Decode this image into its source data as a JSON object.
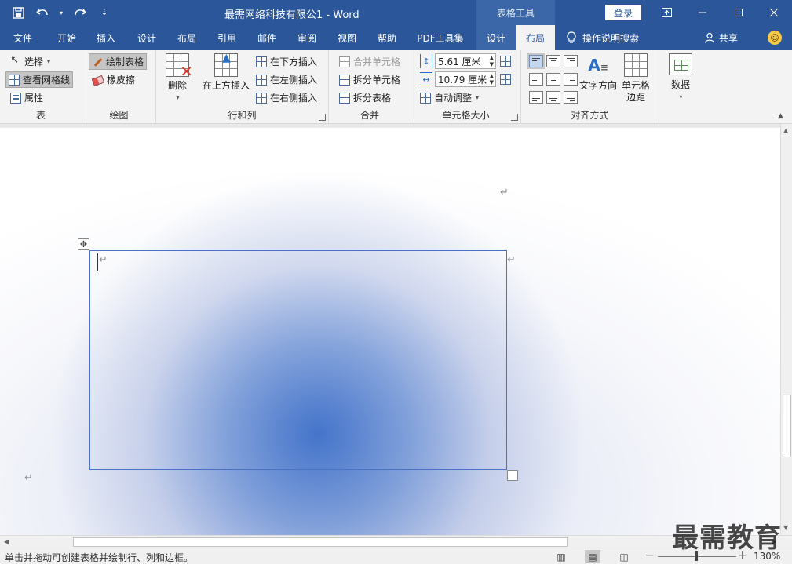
{
  "titlebar": {
    "doc_title": "最需网络科技有限公1 - Word",
    "context_tab_header": "表格工具",
    "login_label": "登录",
    "qat_icons": [
      "save-icon",
      "undo-icon",
      "redo-icon",
      "customize-icon"
    ],
    "window_icons": [
      "ribbon-display-icon",
      "minimize-icon",
      "maximize-icon",
      "close-icon"
    ]
  },
  "tabs": [
    {
      "label": "文件"
    },
    {
      "label": "开始"
    },
    {
      "label": "插入"
    },
    {
      "label": "设计"
    },
    {
      "label": "布局"
    },
    {
      "label": "引用"
    },
    {
      "label": "邮件"
    },
    {
      "label": "审阅"
    },
    {
      "label": "视图"
    },
    {
      "label": "帮助"
    },
    {
      "label": "PDF工具集"
    },
    {
      "label": "设计"
    },
    {
      "label": "布局"
    }
  ],
  "tell_me": "操作说明搜索",
  "share_label": "共享",
  "ribbon": {
    "table_group": {
      "label": "表",
      "select": "选择",
      "view_gridlines": "查看网格线",
      "properties": "属性"
    },
    "draw_group": {
      "label": "绘图",
      "draw_table": "绘制表格",
      "eraser": "橡皮擦"
    },
    "rows_cols_group": {
      "label": "行和列",
      "delete": "删除",
      "insert_above": "在上方插入",
      "insert_below": "在下方插入",
      "insert_left": "在左侧插入",
      "insert_right": "在右侧插入"
    },
    "merge_group": {
      "label": "合并",
      "merge_cells": "合并单元格",
      "split_cells": "拆分单元格",
      "split_table": "拆分表格"
    },
    "cell_size_group": {
      "label": "单元格大小",
      "height": "5.61 厘米",
      "width": "10.79 厘米",
      "autofit": "自动调整"
    },
    "alignment_group": {
      "label": "对齐方式",
      "text_direction": "文字方向",
      "cell_margins_line1": "单元格",
      "cell_margins_line2": "边距"
    },
    "data_group": {
      "data": "数据"
    }
  },
  "document": {
    "para_mark": "↵"
  },
  "statusbar": {
    "text": "单击并拖动可创建表格并绘制行、列和边框。",
    "zoom": "130%"
  },
  "watermark": "最需教育"
}
